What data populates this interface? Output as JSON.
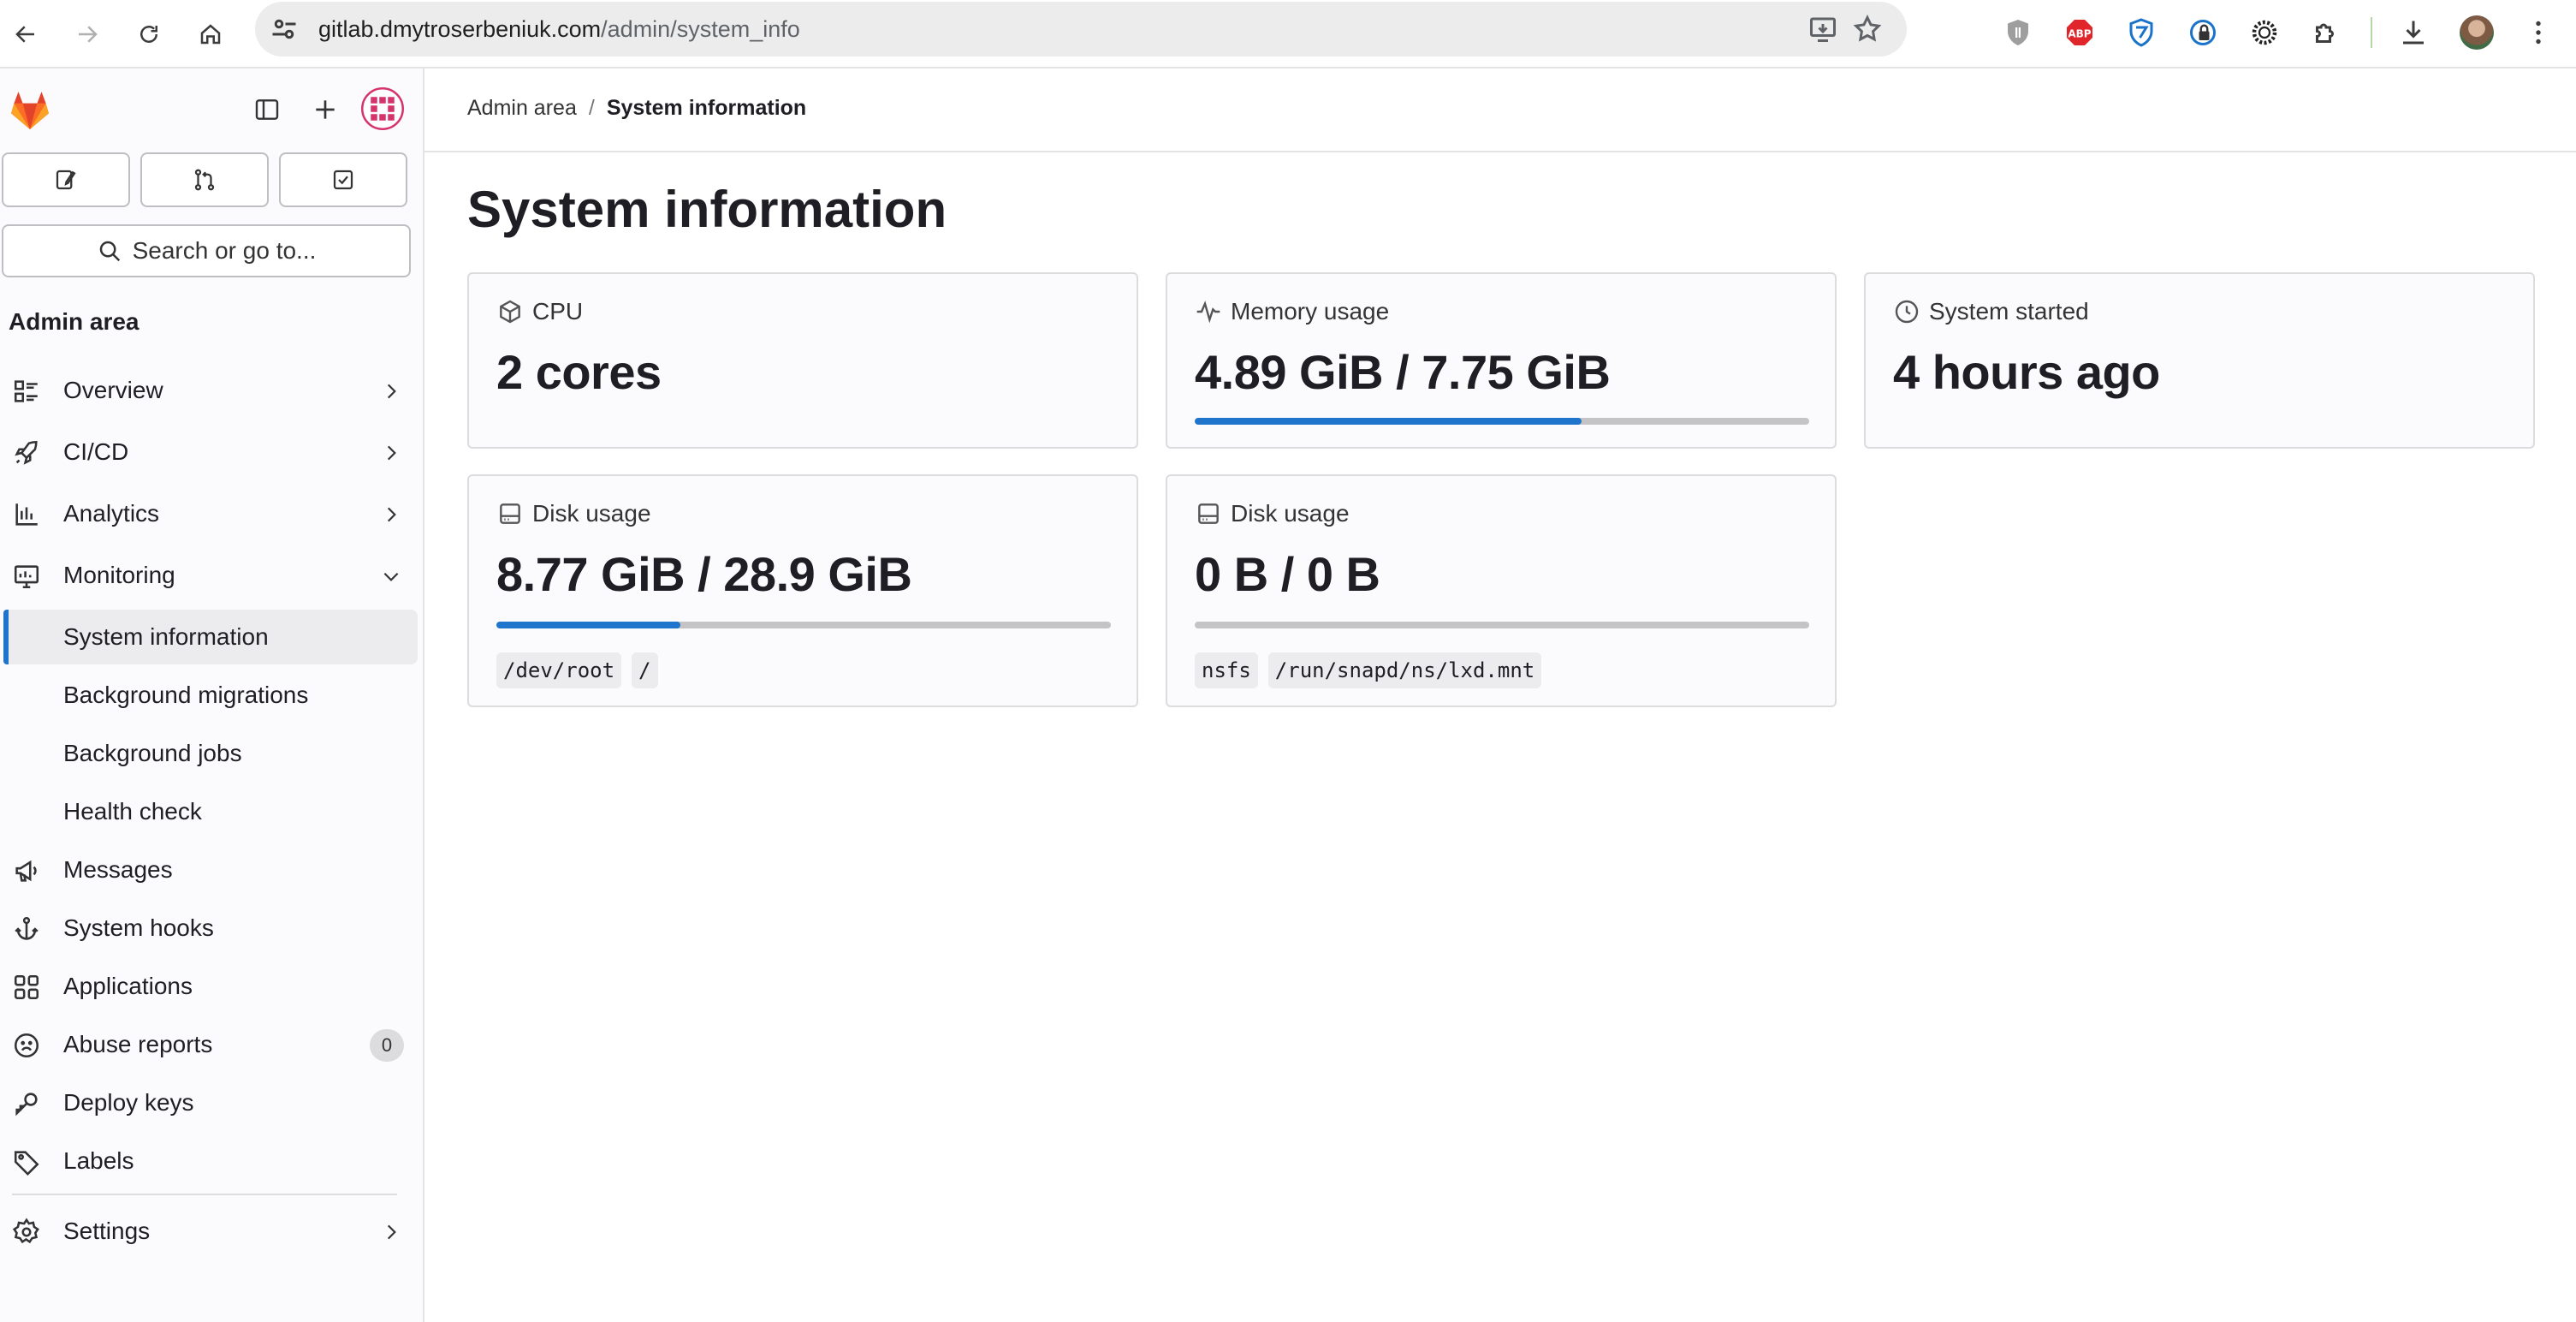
{
  "browser": {
    "url_host": "gitlab.dmytroserbeniuk.com",
    "url_path": "/admin/system_info"
  },
  "sidebar": {
    "search_placeholder": "Search or go to...",
    "heading": "Admin area",
    "items": [
      {
        "label": "Overview",
        "icon": "overview-icon",
        "expandable": true
      },
      {
        "label": "CI/CD",
        "icon": "rocket-icon",
        "expandable": true
      },
      {
        "label": "Analytics",
        "icon": "chart-icon",
        "expandable": true
      },
      {
        "label": "Monitoring",
        "icon": "monitor-icon",
        "expanded": true
      },
      {
        "label": "System information",
        "active": true
      },
      {
        "label": "Background migrations"
      },
      {
        "label": "Background jobs"
      },
      {
        "label": "Health check"
      },
      {
        "label": "Messages",
        "icon": "megaphone-icon"
      },
      {
        "label": "System hooks",
        "icon": "anchor-icon"
      },
      {
        "label": "Applications",
        "icon": "applications-icon"
      },
      {
        "label": "Abuse reports",
        "icon": "abuse-icon",
        "badge": "0"
      },
      {
        "label": "Deploy keys",
        "icon": "key-icon"
      },
      {
        "label": "Labels",
        "icon": "label-icon"
      },
      {
        "label": "Settings",
        "icon": "settings-icon",
        "expandable": true
      }
    ]
  },
  "breadcrumb": {
    "parent": "Admin area",
    "separator": "/",
    "current": "System information"
  },
  "page": {
    "title": "System information"
  },
  "cards": {
    "cpu": {
      "title": "CPU",
      "value": "2 cores"
    },
    "memory": {
      "title": "Memory usage",
      "value": "4.89 GiB / 7.75 GiB",
      "used_fraction": 0.63
    },
    "started": {
      "title": "System started",
      "value": "4 hours ago"
    },
    "disk1": {
      "title": "Disk usage",
      "value": "8.77 GiB / 28.9 GiB",
      "used_fraction": 0.3,
      "device": "/dev/root",
      "mount": "/"
    },
    "disk2": {
      "title": "Disk usage",
      "value": "0 B / 0 B",
      "used_fraction": 0,
      "device": "nsfs",
      "mount": "/run/snapd/ns/lxd.mnt"
    }
  },
  "colors": {
    "accent": "#1f75cb",
    "progress_track": "#c4c4c7"
  }
}
